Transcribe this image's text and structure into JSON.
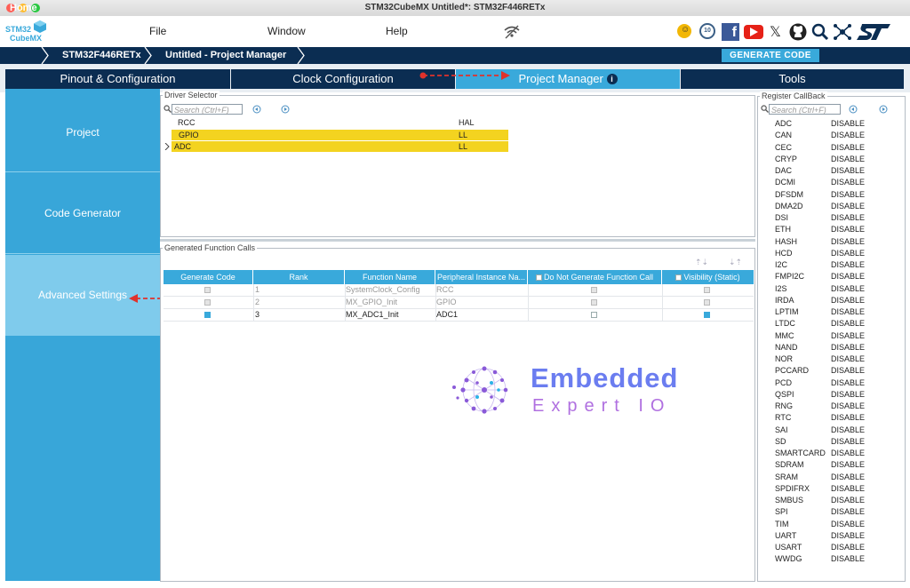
{
  "window": {
    "title": "STM32CubeMX Untitled*: STM32F446RETx"
  },
  "logo": {
    "line1": "STM32",
    "line2": "CubeMX"
  },
  "menu": {
    "file": "File",
    "window": "Window",
    "help": "Help"
  },
  "toolbar_icons": [
    "notification-icon",
    "anniversary-badge-icon",
    "facebook-icon",
    "youtube-icon",
    "x-icon",
    "github-icon",
    "community-search-icon",
    "network-icon",
    "st-logo-icon"
  ],
  "breadcrumb": [
    "Home",
    "STM32F446RETx",
    "Untitled - Project Manager"
  ],
  "generate_button": "GENERATE CODE",
  "tabs": {
    "pinout": "Pinout & Configuration",
    "clock": "Clock Configuration",
    "project": "Project Manager",
    "tools": "Tools"
  },
  "sidebar": {
    "project": "Project",
    "codegen": "Code Generator",
    "advanced": "Advanced Settings"
  },
  "driver_selector": {
    "title": "Driver Selector",
    "search_placeholder": "Search (Ctrl+F)",
    "col1": "RCC",
    "col2": "HAL",
    "rows": [
      {
        "name": "GPIO",
        "driver": "LL"
      },
      {
        "name": "ADC",
        "driver": "LL"
      }
    ]
  },
  "function_calls": {
    "title": "Generated Function Calls",
    "headers": [
      "Generate Code",
      "Rank",
      "Function Name",
      "Peripheral Instance Na...",
      "Do Not Generate Function Call",
      "Visibility (Static)"
    ],
    "rows": [
      {
        "rank": "1",
        "fn": "SystemClock_Config",
        "periph": "RCC"
      },
      {
        "rank": "2",
        "fn": "MX_GPIO_Init",
        "periph": "GPIO"
      },
      {
        "rank": "3",
        "fn": "MX_ADC1_Init",
        "periph": "ADC1"
      }
    ]
  },
  "watermark": {
    "line1": "Embedded",
    "line2": "Expert IO"
  },
  "register_callback": {
    "title": "Register CallBack",
    "search_placeholder": "Search (Ctrl+F)",
    "value": "DISABLE",
    "items": [
      "ADC",
      "CAN",
      "CEC",
      "CRYP",
      "DAC",
      "DCMI",
      "DFSDM",
      "DMA2D",
      "DSI",
      "ETH",
      "HASH",
      "HCD",
      "I2C",
      "FMPI2C",
      "I2S",
      "IRDA",
      "LPTIM",
      "LTDC",
      "MMC",
      "NAND",
      "NOR",
      "PCCARD",
      "PCD",
      "QSPI",
      "RNG",
      "RTC",
      "SAI",
      "SD",
      "SMARTCARD",
      "SDRAM",
      "SRAM",
      "SPDIFRX",
      "SMBUS",
      "SPI",
      "TIM",
      "UART",
      "USART",
      "WWDG"
    ]
  },
  "colors": {
    "navy": "#0b2d52",
    "accent": "#39a9db",
    "highlight": "#f3d320",
    "arrow": "#e0322b"
  }
}
